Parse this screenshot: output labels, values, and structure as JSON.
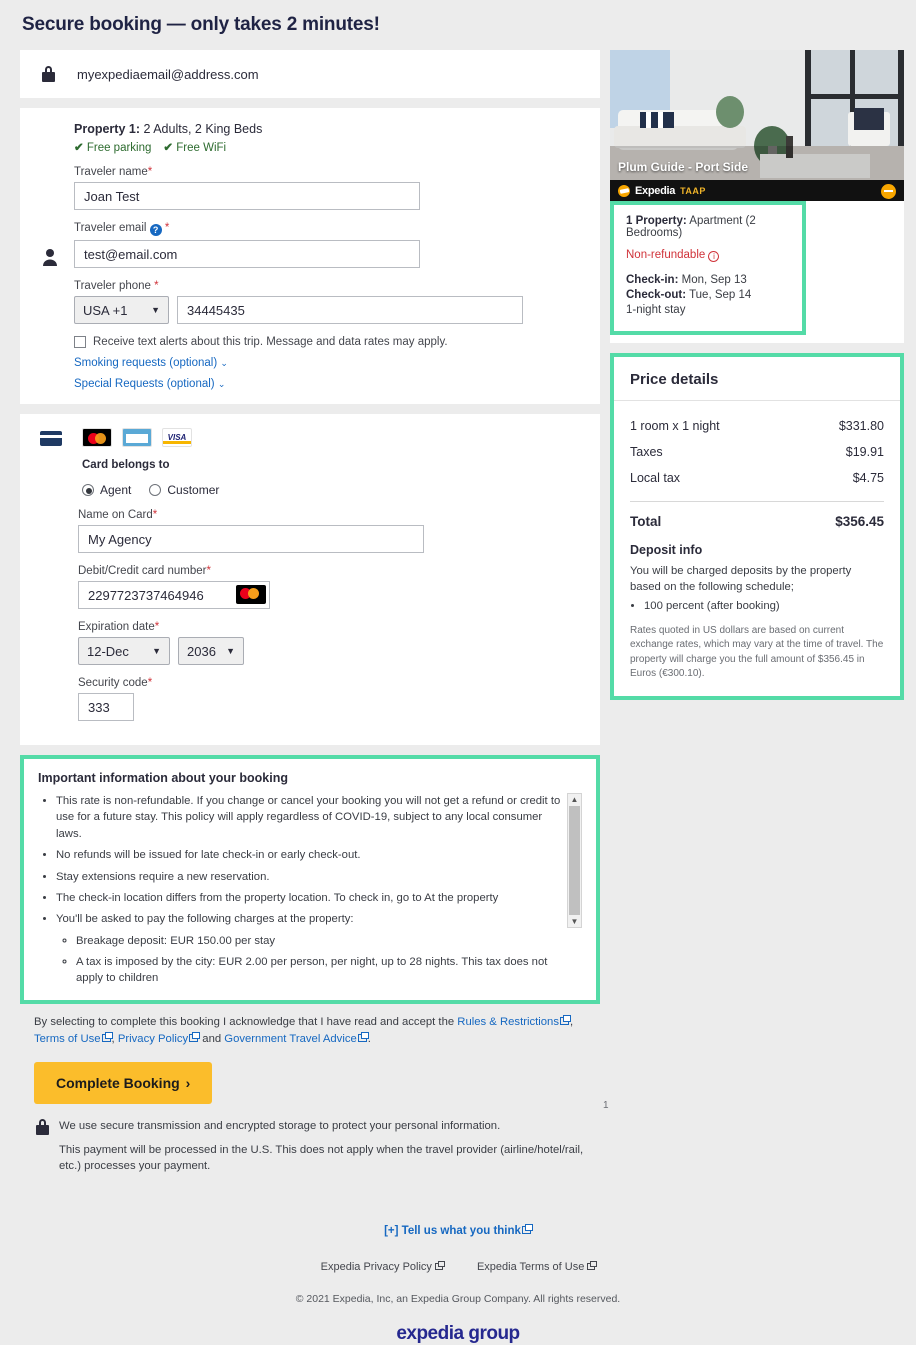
{
  "page": {
    "title": "Secure booking — only takes 2 minutes!"
  },
  "account": {
    "icon": "lock-icon",
    "email": "myexpediaemail@address.com"
  },
  "property_form": {
    "icon": "person-icon",
    "label": "Property 1:",
    "occupancy": "2 Adults, 2 King Beds",
    "amenities": [
      "Free parking",
      "Free WiFi"
    ],
    "traveler_name": {
      "label": "Traveler name",
      "value": "Joan Test",
      "required": "*"
    },
    "traveler_email": {
      "label": "Traveler email",
      "value": "test@email.com",
      "required": "*",
      "help_icon": "question-icon"
    },
    "traveler_phone": {
      "label": "Traveler phone",
      "required": "*",
      "country": "USA +1",
      "number": "34445435"
    },
    "text_alerts": "Receive text alerts about this trip. Message and data rates may apply.",
    "smoking_requests": "Smoking requests (optional)",
    "special_requests": "Special Requests (optional)"
  },
  "payment": {
    "card_icons": [
      "card-icon",
      "mastercard-icon",
      "amex-icon",
      "visa-icon"
    ],
    "belongs_label": "Card belongs to",
    "options": [
      {
        "label": "Agent",
        "selected": true
      },
      {
        "label": "Customer",
        "selected": false
      }
    ],
    "name_on_card": {
      "label": "Name on Card",
      "value": "My Agency",
      "required": "*"
    },
    "card_number": {
      "label": "Debit/Credit card number",
      "value": "2297723737464946",
      "required": "*",
      "brand_icon": "mastercard-icon"
    },
    "expiration": {
      "label": "Expiration date",
      "required": "*",
      "month": "12-Dec",
      "year": "2036"
    },
    "security_code": {
      "label": "Security code",
      "value": "333",
      "required": "*"
    }
  },
  "important_info": {
    "title": "Important information about your booking",
    "bullets": [
      "This rate is non-refundable. If you change or cancel your booking you will not get a refund or credit to use for a future stay. This policy will apply regardless of COVID-19, subject to any local consumer laws.",
      "No refunds will be issued for late check-in or early check-out.",
      "Stay extensions require a new reservation.",
      "The check-in location differs from the property location. To check in, go to At the property",
      "You'll be asked to pay the following charges at the property:"
    ],
    "sub_bullets": [
      "Breakage deposit: EUR 150.00 per stay",
      "A tax is imposed by the city: EUR 2.00 per person, per night, up to 28 nights. This tax does not apply to children"
    ]
  },
  "terms": {
    "prefix": "By selecting to complete this booking I acknowledge that I have read and accept the",
    "links": [
      "Rules & Restrictions",
      "Terms of Use",
      "Privacy Policy",
      "Government Travel Advice"
    ],
    "and": "and",
    "comma": ",",
    "period": "."
  },
  "cta": {
    "label": "Complete Booking",
    "chevron": "›"
  },
  "secure": {
    "icon": "lock-icon",
    "line1": "We use secure transmission and encrypted storage to protect your personal information.",
    "line2": "This payment will be processed in the U.S. This does not apply when the travel provider (airline/hotel/rail, etc.) processes your payment."
  },
  "sidebar": {
    "photo_caption": "Plum Guide - Port Side",
    "brand": {
      "name": "Expedia",
      "program": "TAAP",
      "minimize_icon": "minimize-icon"
    },
    "summary": {
      "property_label": "1 Property:",
      "property_value": "Apartment (2 Bedrooms)",
      "refund_status": "Non-refundable",
      "info_icon": "info-icon",
      "checkin_label": "Check-in:",
      "checkin_value": "Mon, Sep 13",
      "checkout_label": "Check-out:",
      "checkout_value": "Tue, Sep 14",
      "stay": "1-night stay"
    },
    "price_details": {
      "heading": "Price details",
      "rows": [
        {
          "label": "1 room x 1 night",
          "amount": "$331.80"
        },
        {
          "label": "Taxes",
          "amount": "$19.91"
        },
        {
          "label": "Local tax",
          "amount": "$4.75"
        }
      ],
      "total_label": "Total",
      "total_amount": "$356.45",
      "deposit_title": "Deposit info",
      "deposit_text": "You will be charged deposits by the property based on the following schedule;",
      "deposit_items": [
        "100 percent (after booking)"
      ],
      "fineprint": "Rates quoted in US dollars are based on current exchange rates, which may vary at the time of travel. The property will charge you the full amount of $356.45 in Euros (€300.10)."
    }
  },
  "footer": {
    "tell_us": "[+] Tell us what you think",
    "links": [
      "Expedia Privacy Policy",
      "Expedia Terms of Use"
    ],
    "copyright": "© 2021 Expedia, Inc, an Expedia Group Company. All rights reserved.",
    "logo": "expedia group",
    "stray_marker": "1"
  },
  "colors": {
    "accent_green": "#54dba7",
    "cta_amber": "#fbbd2b",
    "link_blue": "#1668c1",
    "alert_red": "#d0333a"
  }
}
